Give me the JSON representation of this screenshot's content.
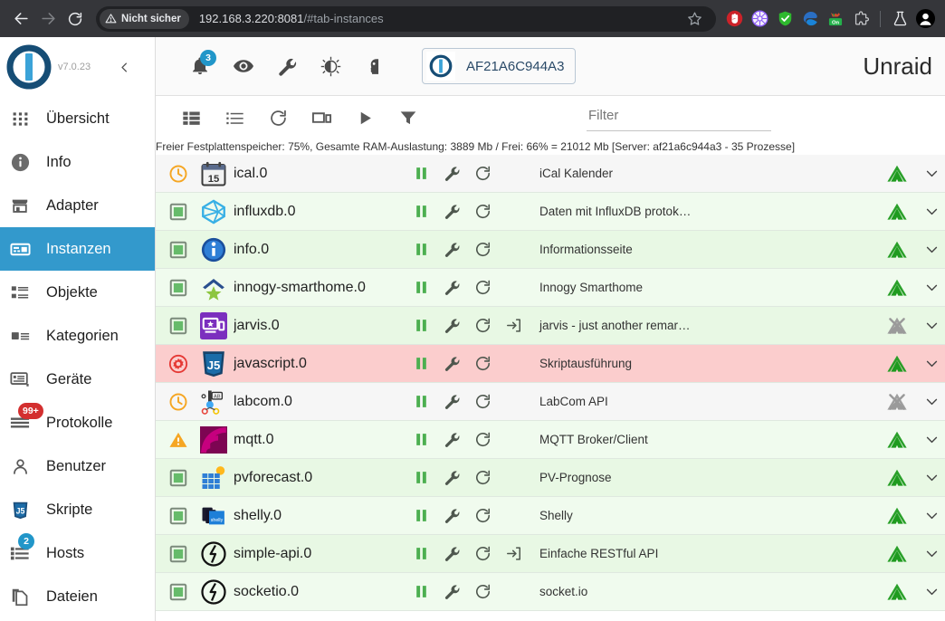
{
  "browser": {
    "back_icon": "back-arrow-icon",
    "forward_icon": "forward-arrow-icon",
    "reload_icon": "reload-icon",
    "security_label": "Nicht sicher",
    "url_host": "192.168.3.220:8081",
    "url_path": "/#tab-instances",
    "bookmark_icon": "star-icon",
    "extensions": [
      {
        "name": "ublock-origin-extension-icon",
        "color": "#cc2229"
      },
      {
        "name": "violentmonkey-extension-icon",
        "color": "#8b5cf6"
      },
      {
        "name": "privacy-badger-extension-icon",
        "color": "#2eb82e"
      },
      {
        "name": "edge-extension-icon",
        "color": "#1a84d8"
      },
      {
        "name": "tampermonkey-extension-icon",
        "color": "#24b14b"
      },
      {
        "name": "extensions-puzzle-icon",
        "color": "#9aa0a6"
      }
    ],
    "labs_icon": "flask-icon",
    "profile_icon": "profile-avatar-icon"
  },
  "sidebar": {
    "logo_name": "iobroker-logo",
    "version": "v7.0.23",
    "collapse_icon": "chevron-left-icon",
    "items": [
      {
        "label": "Übersicht",
        "icon": "grid-apps-icon",
        "active": false,
        "badge": null
      },
      {
        "label": "Info",
        "icon": "info-circle-icon",
        "active": false,
        "badge": null
      },
      {
        "label": "Adapter",
        "icon": "store-icon",
        "active": false,
        "badge": null
      },
      {
        "label": "Instanzen",
        "icon": "instances-icon",
        "active": true,
        "badge": null
      },
      {
        "label": "Objekte",
        "icon": "list-objects-icon",
        "active": false,
        "badge": null
      },
      {
        "label": "Kategorien",
        "icon": "categories-icon",
        "active": false,
        "badge": null
      },
      {
        "label": "Geräte",
        "icon": "devices-icon",
        "active": false,
        "badge": null
      },
      {
        "label": "Protokolle",
        "icon": "logs-icon",
        "active": false,
        "badge": "99+",
        "badge_color": "red"
      },
      {
        "label": "Benutzer",
        "icon": "user-icon",
        "active": false,
        "badge": null
      },
      {
        "label": "Skripte",
        "icon": "javascript-icon",
        "active": false,
        "badge": null
      },
      {
        "label": "Hosts",
        "icon": "hosts-server-icon",
        "active": false,
        "badge": "2",
        "badge_color": "blue"
      },
      {
        "label": "Dateien",
        "icon": "files-copy-icon",
        "active": false,
        "badge": null
      }
    ]
  },
  "topbar": {
    "icons": [
      {
        "name": "notifications-bell-icon",
        "badge": "3"
      },
      {
        "name": "eye-icon",
        "badge": null
      },
      {
        "name": "wrench-icon",
        "badge": null
      },
      {
        "name": "theme-contrast-icon",
        "badge": null
      },
      {
        "name": "expert-mode-icon",
        "badge": null
      }
    ],
    "host_chip_icon": "iobroker-logo-small",
    "host_chip_name": "AF21A6C944A3",
    "page_title": "Unraid"
  },
  "toolbar": {
    "icons": [
      {
        "name": "view-table-icon"
      },
      {
        "name": "view-list-icon"
      },
      {
        "name": "refresh-icon"
      },
      {
        "name": "host-select-icon"
      },
      {
        "name": "start-all-icon"
      },
      {
        "name": "filter-funnel-icon"
      }
    ],
    "filter_placeholder": "Filter",
    "filter_value": ""
  },
  "status_strip": {
    "text": "Freier Festplattenspeicher: 75%, Gesamte RAM-Auslastung: 3889 Mb / Frei: 66% = 21012 Mb [Server: af21a6c944a3 - 35 Prozesse]"
  },
  "table": {
    "rows": [
      {
        "id": "ical.0",
        "name": "ical.0",
        "description": "iCal Kalender",
        "status": "scheduled",
        "adapter_icon": "ical-calendar-icon",
        "row_bg": "grey",
        "connected": true,
        "has_link": false,
        "actions": [
          "pause",
          "wrench",
          "reload"
        ],
        "chevron": "chevron-down-icon"
      },
      {
        "id": "influxdb.0",
        "name": "influxdb.0",
        "description": "Daten mit InfluxDB protok…",
        "status": "running",
        "adapter_icon": "influxdb-icon",
        "row_bg": "b",
        "connected": true,
        "has_link": false,
        "actions": [
          "pause",
          "wrench",
          "reload"
        ],
        "chevron": "chevron-down-icon"
      },
      {
        "id": "info.0",
        "name": "info.0",
        "description": "Informationsseite",
        "status": "running",
        "adapter_icon": "info-blue-icon",
        "row_bg": "a",
        "connected": true,
        "has_link": false,
        "actions": [
          "pause",
          "wrench",
          "reload"
        ],
        "chevron": "chevron-down-icon"
      },
      {
        "id": "innogy-smarthome.0",
        "name": "innogy-smarthome.0",
        "description": "Innogy Smarthome",
        "status": "running",
        "adapter_icon": "innogy-house-star-icon",
        "row_bg": "b",
        "connected": true,
        "has_link": false,
        "actions": [
          "pause",
          "wrench",
          "reload"
        ],
        "chevron": "chevron-down-icon"
      },
      {
        "id": "jarvis.0",
        "name": "jarvis.0",
        "description": "jarvis - just another remar…",
        "status": "running",
        "adapter_icon": "jarvis-screen-icon",
        "row_bg": "a",
        "connected": false,
        "has_link": true,
        "actions": [
          "pause",
          "wrench",
          "reload",
          "link"
        ],
        "chevron": "chevron-down-icon"
      },
      {
        "id": "javascript.0",
        "name": "javascript.0",
        "description": "Skriptausführung",
        "status": "error",
        "adapter_icon": "javascript-js-icon",
        "row_bg": "red",
        "connected": true,
        "has_link": false,
        "actions": [
          "pause",
          "wrench",
          "reload"
        ],
        "chevron": "chevron-down-icon"
      },
      {
        "id": "labcom.0",
        "name": "labcom.0",
        "description": "LabCom API",
        "status": "scheduled",
        "adapter_icon": "labcom-icon",
        "row_bg": "grey",
        "connected": false,
        "has_link": false,
        "actions": [
          "pause",
          "wrench",
          "reload"
        ],
        "chevron": "chevron-down-icon"
      },
      {
        "id": "mqtt.0",
        "name": "mqtt.0",
        "description": "MQTT Broker/Client",
        "status": "warning",
        "adapter_icon": "mqtt-signal-icon",
        "row_bg": "b",
        "connected": true,
        "has_link": false,
        "actions": [
          "pause",
          "wrench",
          "reload"
        ],
        "chevron": "chevron-down-icon"
      },
      {
        "id": "pvforecast.0",
        "name": "pvforecast.0",
        "description": "PV-Prognose",
        "status": "running",
        "adapter_icon": "pvforecast-solar-icon",
        "row_bg": "a",
        "connected": true,
        "has_link": false,
        "actions": [
          "pause",
          "wrench",
          "reload"
        ],
        "chevron": "chevron-down-icon"
      },
      {
        "id": "shelly.0",
        "name": "shelly.0",
        "description": "Shelly",
        "status": "running",
        "adapter_icon": "shelly-icon",
        "row_bg": "b",
        "connected": true,
        "has_link": false,
        "actions": [
          "pause",
          "wrench",
          "reload"
        ],
        "chevron": "chevron-down-icon"
      },
      {
        "id": "simple-api.0",
        "name": "simple-api.0",
        "description": "Einfache RESTful API",
        "status": "running",
        "adapter_icon": "simple-api-icon",
        "row_bg": "a",
        "connected": true,
        "has_link": true,
        "actions": [
          "pause",
          "wrench",
          "reload",
          "link"
        ],
        "chevron": "chevron-down-icon"
      },
      {
        "id": "socketio.0",
        "name": "socketio.0",
        "description": "socket.io",
        "status": "running",
        "adapter_icon": "socketio-icon",
        "row_bg": "b",
        "connected": true,
        "has_link": false,
        "actions": [
          "pause",
          "wrench",
          "reload"
        ],
        "chevron": "chevron-down-icon"
      }
    ]
  },
  "colors": {
    "accent": "#3399cc",
    "running": "#4caf50",
    "error": "#e53935",
    "warning": "#f5a623",
    "scheduled": "#f5a623",
    "row_green_dark": "#e8f8e4",
    "row_green_light": "#f0fbee",
    "row_red": "#fbcdcd",
    "row_grey": "#f6f6f6",
    "connected": "#2e9e2e",
    "disconnected": "#9e9e9e"
  }
}
